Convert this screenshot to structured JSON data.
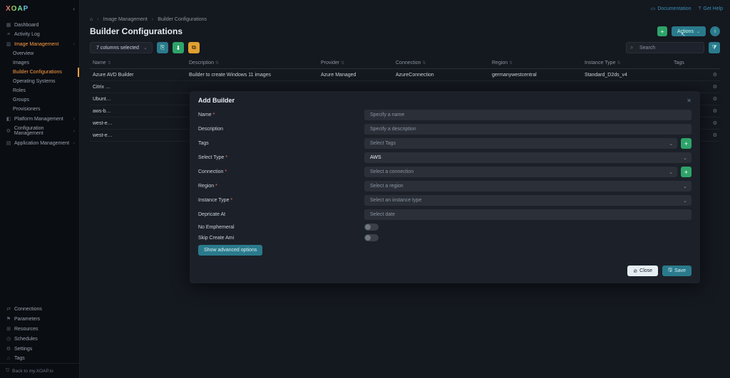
{
  "brand": "XOAP",
  "topbar": {
    "doc": "Documentation",
    "help": "Get Help"
  },
  "sidebar": {
    "upper": [
      {
        "label": "Dashboard",
        "icon": "▦"
      },
      {
        "label": "Activity Log",
        "icon": "≡"
      },
      {
        "label": "Image Management",
        "icon": "▥",
        "expandable": true,
        "active_section": true
      },
      {
        "label": "Overview",
        "sub": true
      },
      {
        "label": "Images",
        "sub": true
      },
      {
        "label": "Builder Configurations",
        "sub": true,
        "active": true
      },
      {
        "label": "Operating Systems",
        "sub": true
      },
      {
        "label": "Roles",
        "sub": true
      },
      {
        "label": "Groups",
        "sub": true
      },
      {
        "label": "Provisioners",
        "sub": true
      },
      {
        "label": "Platform Management",
        "icon": "◧",
        "expandable": true
      },
      {
        "label": "Configuration Management",
        "icon": "⚙",
        "expandable": true
      },
      {
        "label": "Application Management",
        "icon": "▤",
        "expandable": true
      }
    ],
    "lower": [
      {
        "label": "Connections",
        "icon": "⇄"
      },
      {
        "label": "Parameters",
        "icon": "⚑"
      },
      {
        "label": "Resources",
        "icon": "⊞"
      },
      {
        "label": "Schedules",
        "icon": "◷"
      },
      {
        "label": "Settings",
        "icon": "⚙"
      },
      {
        "label": "Tags",
        "icon": "⌂"
      }
    ],
    "back": "Back to my.XOAP.io"
  },
  "crumbs": {
    "home_icon": "⌂",
    "a": "Image Management",
    "b": "Builder Configurations"
  },
  "page": {
    "title": "Builder Configurations",
    "actions_label": "Actions",
    "avatar": "i"
  },
  "toolbar": {
    "columns": "7 columns selected",
    "search_placeholder": "Search"
  },
  "table": {
    "headers": {
      "name": "Name",
      "desc": "Description",
      "prov": "Provider",
      "conn": "Connection",
      "reg": "Region",
      "inst": "Instance Type",
      "tags": "Tags"
    },
    "rows": [
      {
        "name": "Azure AVD Builder",
        "desc": "Builder to create Windows 11 images",
        "prov": "Azure Managed",
        "conn": "AzureConnection",
        "reg": "germanywestcentral",
        "inst": "Standard_D2ds_v4"
      },
      {
        "name": "Citrix …"
      },
      {
        "name": "Ubunt…"
      },
      {
        "name": "aws-b…"
      },
      {
        "name": "west-e…"
      },
      {
        "name": "west-e…"
      }
    ]
  },
  "modal": {
    "title": "Add Builder",
    "name_label": "Name",
    "name_ph": "Specify a name",
    "desc_label": "Description",
    "desc_ph": "Specify a description",
    "tags_label": "Tags",
    "tags_ph": "Select Tags",
    "type_label": "Select Type",
    "type_val": "AWS",
    "conn_label": "Connection",
    "conn_ph": "Select a connection",
    "region_label": "Region",
    "region_ph": "Select a region",
    "inst_label": "Instance Type",
    "inst_ph": "Select an instance type",
    "depr_label": "Depricate At",
    "depr_ph": "Select date",
    "noeph_label": "No Emphemeral",
    "skip_label": "Skip Create Ami",
    "adv": "Show advanced options",
    "close": "Close",
    "save": "Save"
  }
}
